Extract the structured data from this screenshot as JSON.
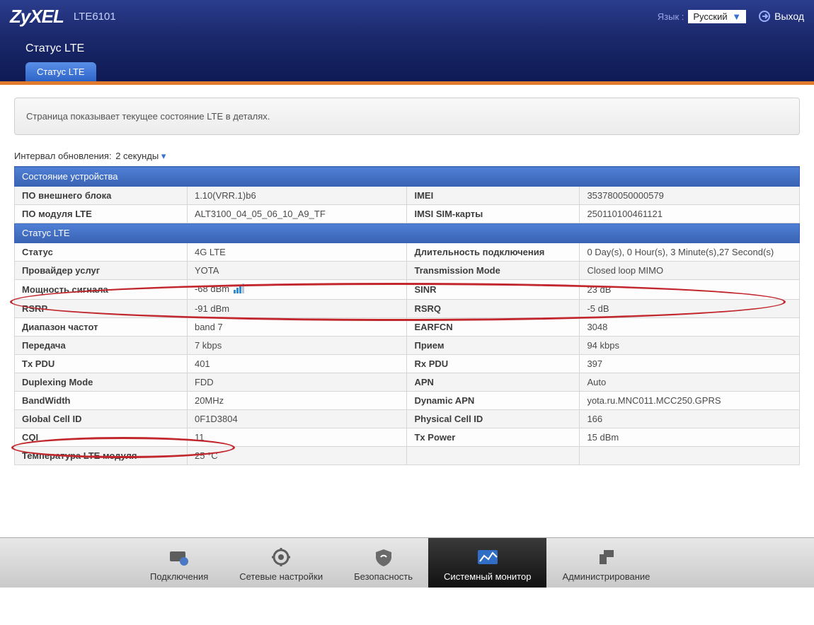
{
  "header": {
    "brand": "ZyXEL",
    "model": "LTE6101",
    "lang_label": "Язык :",
    "lang_value": "Русский",
    "logout": "Выход"
  },
  "page": {
    "title": "Статус LTE",
    "tab": "Статус LTE",
    "banner": "Страница показывает текущее состояние LTE в деталях.",
    "refresh_label": "Интервал обновления:",
    "refresh_value": "2 секунды"
  },
  "sections": {
    "device": {
      "title": "Состояние устройства",
      "rows": [
        {
          "l1": "ПО внешнего блока",
          "v1": "1.10(VRR.1)b6",
          "l2": "IMEI",
          "v2": "353780050000579"
        },
        {
          "l1": "ПО модуля LTE",
          "v1": "ALT3100_04_05_06_10_A9_TF",
          "l2": "IMSI SIM-карты",
          "v2": "250110100461121"
        }
      ]
    },
    "lte": {
      "title": "Статус LTE",
      "rows": [
        {
          "l1": "Статус",
          "v1": "4G LTE",
          "l2": "Длительность подключения",
          "v2": "0 Day(s), 0 Hour(s), 3 Minute(s),27 Second(s)"
        },
        {
          "l1": "Провайдер услуг",
          "v1": "YOTA",
          "l2": "Transmission Mode",
          "v2": "Closed loop MIMO"
        },
        {
          "l1": "Мощность сигнала",
          "v1": "-68 dBm",
          "v1_signal": true,
          "l2": "SINR",
          "v2": "23 dB"
        },
        {
          "l1": "RSRP",
          "v1": "-91 dBm",
          "l2": "RSRQ",
          "v2": "-5 dB"
        },
        {
          "l1": "Диапазон частот",
          "v1": "band 7",
          "l2": "EARFCN",
          "v2": "3048"
        },
        {
          "l1": "Передача",
          "v1": "7 kbps",
          "l2": "Прием",
          "v2": "94 kbps"
        },
        {
          "l1": "Tx PDU",
          "v1": "401",
          "l2": "Rx PDU",
          "v2": "397"
        },
        {
          "l1": "Duplexing Mode",
          "v1": "FDD",
          "l2": "APN",
          "v2": "Auto"
        },
        {
          "l1": "BandWidth",
          "v1": "20MHz",
          "l2": "Dynamic APN",
          "v2": "yota.ru.MNC011.MCC250.GPRS"
        },
        {
          "l1": "Global Cell ID",
          "v1": "0F1D3804",
          "l2": "Physical Cell ID",
          "v2": "166"
        },
        {
          "l1": "CQI",
          "v1": "11",
          "l2": "Tx Power",
          "v2": "15 dBm"
        },
        {
          "l1": "Температура LTE модуля",
          "v1": "25 °C",
          "l2": "",
          "v2": ""
        }
      ]
    }
  },
  "nav": {
    "items": [
      {
        "label": "Подключения"
      },
      {
        "label": "Сетевые настройки"
      },
      {
        "label": "Безопасность"
      },
      {
        "label": "Системный монитор",
        "active": true
      },
      {
        "label": "Администрирование"
      }
    ]
  }
}
